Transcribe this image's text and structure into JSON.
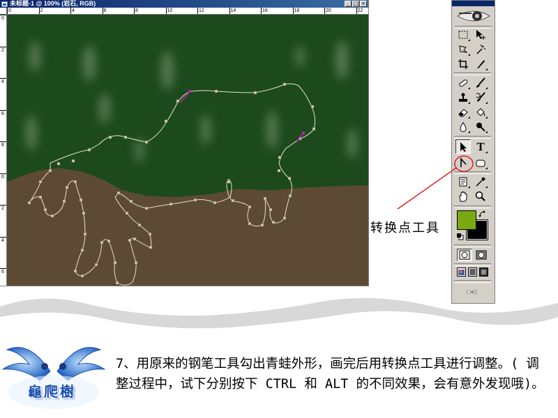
{
  "document_window": {
    "title": "未标题-1 @ 100% (岩石, RGB)",
    "controls": {
      "minimize": "_",
      "maximize": "□",
      "close": "×"
    },
    "ruler_horizontal": [
      "0",
      "2",
      "4",
      "6",
      "8",
      "10",
      "12",
      "14",
      "16",
      "18",
      "20",
      "22"
    ],
    "ruler_vertical": [
      "0",
      "2",
      "4",
      "6",
      "8",
      "0",
      "2",
      "4",
      "6"
    ]
  },
  "canvas": {
    "sky_color": "#1c4a1c",
    "ground_color": "#5c4a35",
    "path_color": "#e8e0c8",
    "anchor_color": "#d8d0b8",
    "selected_anchor_color": "#c020c0"
  },
  "toolbox": {
    "tools": [
      {
        "name": "rectangular-marquee-tool"
      },
      {
        "name": "move-tool"
      },
      {
        "name": "lasso-tool"
      },
      {
        "name": "magic-wand-tool"
      },
      {
        "name": "crop-tool"
      },
      {
        "name": "slice-tool"
      },
      {
        "name": "healing-brush-tool"
      },
      {
        "name": "brush-tool"
      },
      {
        "name": "clone-stamp-tool"
      },
      {
        "name": "history-brush-tool"
      },
      {
        "name": "eraser-tool"
      },
      {
        "name": "paint-bucket-tool"
      },
      {
        "name": "blur-tool"
      },
      {
        "name": "dodge-tool"
      },
      {
        "name": "path-selection-tool"
      },
      {
        "name": "type-tool"
      },
      {
        "name": "convert-point-tool"
      },
      {
        "name": "rectangle-shape-tool"
      },
      {
        "name": "notes-tool"
      },
      {
        "name": "eyedropper-tool"
      },
      {
        "name": "hand-tool"
      },
      {
        "name": "zoom-tool"
      }
    ],
    "type_tool_glyph": "T",
    "foreground_color": "#7aaa10",
    "background_color": "#000000",
    "highlight_color": "#e02020"
  },
  "annotation": {
    "label": "转换点工具"
  },
  "caption": {
    "text": "7、用原来的钢笔工具勾出青蛙外形，画完后用转换点工具进行调整。( 调整过程中，试下分别按下 CTRL 和 ALT 的不同效果，会有意外发现哦)。"
  },
  "brand": {
    "text": "龜爬樹",
    "color": "#1a4fb0"
  },
  "banner": {
    "wave_color": "#d8d8d8"
  }
}
